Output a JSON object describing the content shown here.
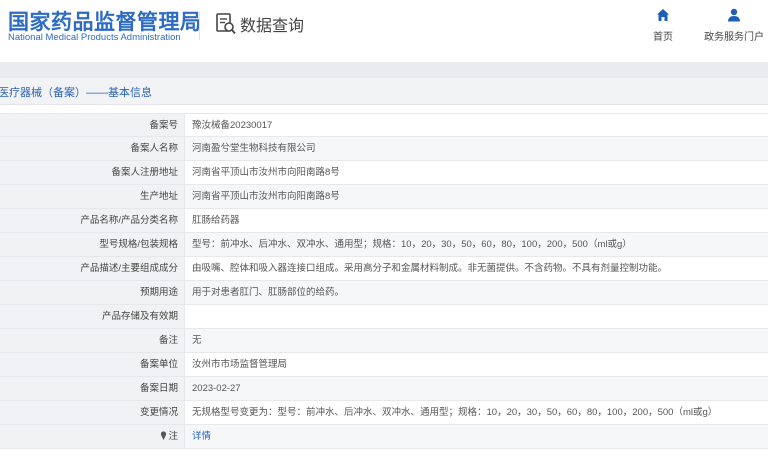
{
  "header": {
    "logo_cn": "国家药品监督管理局",
    "logo_en": "National Medical Products Administration",
    "query_label": "数据查询",
    "nav": [
      {
        "label": "首页",
        "icon": "home-icon"
      },
      {
        "label": "政务服务门户",
        "icon": "user-icon"
      }
    ]
  },
  "section": {
    "title": "医疗器械（备案）——基本信息"
  },
  "colors": {
    "brand": "#2e6cc4",
    "link": "#2b64b8",
    "label_bg": "#f1f2f4",
    "band": "#e9ebef"
  },
  "rows": [
    {
      "label": "备案号",
      "value": "豫汝械备20230017"
    },
    {
      "label": "备案人名称",
      "value": "河南盈兮堂生物科技有限公司"
    },
    {
      "label": "备案人注册地址",
      "value": "河南省平顶山市汝州市向阳南路8号"
    },
    {
      "label": "生产地址",
      "value": "河南省平顶山市汝州市向阳南路8号"
    },
    {
      "label": "产品名称/产品分类名称",
      "value": "肛肠给药器"
    },
    {
      "label": "型号规格/包装规格",
      "value": "型号：前冲水、后冲水、双冲水、通用型；规格：10，20，30，50，60，80，100，200，500（ml或g）"
    },
    {
      "label": "产品描述/主要组成成分",
      "value": "由吸嘴、腔体和吸入器连接口组成。采用高分子和金属材料制成。非无菌提供。不含药物。不具有剂量控制功能。"
    },
    {
      "label": "预期用途",
      "value": "用于对患者肛门、肛肠部位的给药。"
    },
    {
      "label": "产品存储及有效期",
      "value": ""
    },
    {
      "label": "备注",
      "value": "无"
    },
    {
      "label": "备案单位",
      "value": "汝州市市场监督管理局"
    },
    {
      "label": "备案日期",
      "value": "2023-02-27"
    },
    {
      "label": "变更情况",
      "value": "无规格型号变更为：型号：前冲水、后冲水、双冲水、通用型；规格：10，20，30，50，60，80，100，200，500（ml或g）"
    },
    {
      "label": "注",
      "value": "详情"
    }
  ]
}
